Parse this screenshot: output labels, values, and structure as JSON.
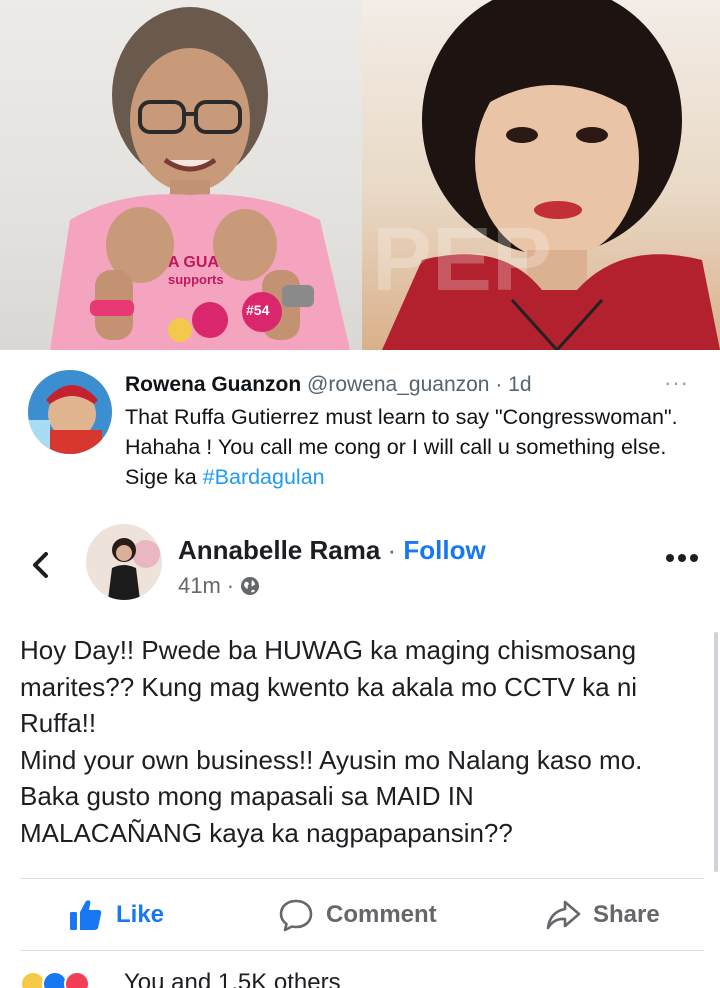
{
  "photos": {
    "left": {
      "shirt_text_line1": "A GUA",
      "shirt_text_line2": "supports",
      "badge": "#54"
    },
    "right": {
      "watermark": "PEP"
    }
  },
  "tweet": {
    "name": "Rowena Guanzon",
    "handle": "@rowena_guanzon",
    "separator": "·",
    "time": "1d",
    "more": "···",
    "text": "That Ruffa Gutierrez must learn  to say \"Congresswoman\". Hahaha ! You call me cong or I will call u something else. Sige ka ",
    "hashtag": "#Bardagulan"
  },
  "post": {
    "author": "Annabelle Rama",
    "separator": " · ",
    "follow_label": "Follow",
    "time": "41m",
    "time_separator": "·",
    "lines": [
      "Hoy Day!!  Pwede ba HUWAG ka maging chismosang",
      "marites?? Kung mag kwento ka akala mo CCTV ka ni",
      "Ruffa!!",
      "Mind your own business!! Ayusin mo Nalang kaso mo.",
      "Baka gusto mong mapasali sa MAID IN",
      "MALACAÑANG kaya ka nagpapapansin??"
    ]
  },
  "actions": {
    "like_label": "Like",
    "comment_label": "Comment",
    "share_label": "Share"
  },
  "reactions": {
    "summary": "You and 1.5K others",
    "icons": [
      "haha-icon",
      "like-icon",
      "love-icon"
    ]
  },
  "colors": {
    "fb_blue": "#1877f2",
    "twitter_blue": "#1d9bf0",
    "muted": "#65676b"
  }
}
